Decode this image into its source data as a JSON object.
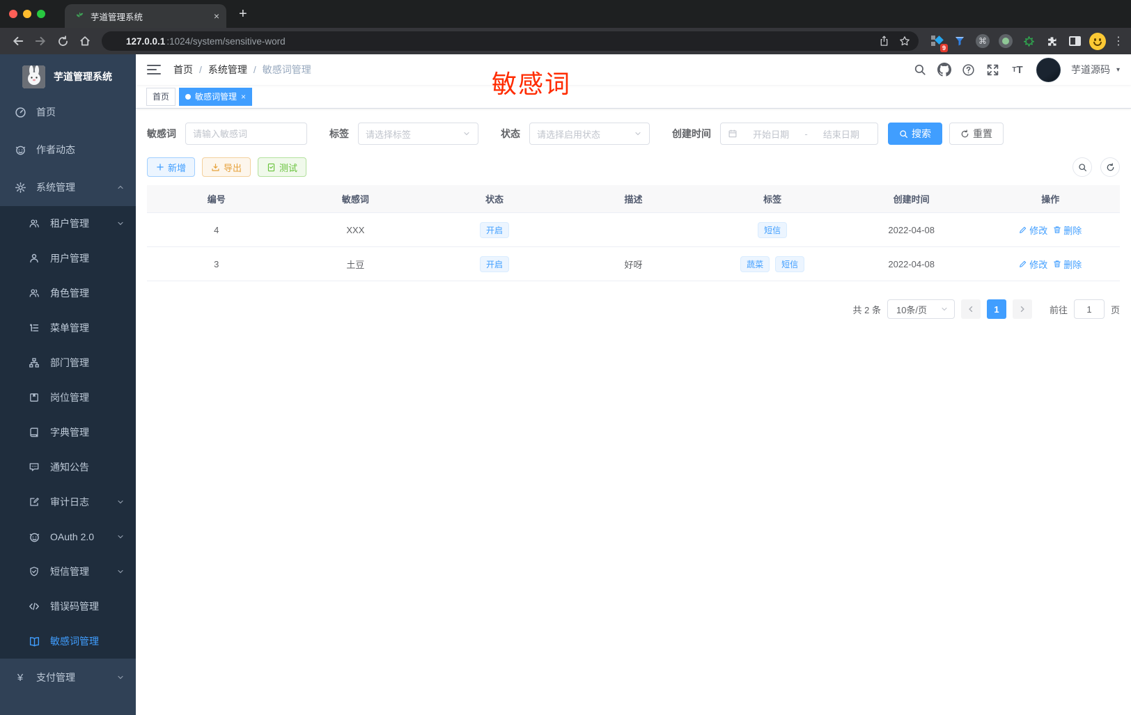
{
  "colors": {
    "accent": "#409eff",
    "success": "#67c23a",
    "warning": "#e6a23c",
    "annotation_red": "#ff2b00",
    "sidebar_bg": "#304156",
    "submenu_bg": "#1f2d3d"
  },
  "browser": {
    "tab_title": "芋道管理系统",
    "url_host": "127.0.0.1",
    "url_path": ":1024/system/sensitive-word",
    "extension_badge": "9"
  },
  "sidebar": {
    "app_title": "芋道管理系统",
    "top_items": [
      {
        "label": "首页"
      },
      {
        "label": "作者动态"
      },
      {
        "label": "系统管理"
      }
    ],
    "system_children": [
      {
        "label": "租户管理"
      },
      {
        "label": "用户管理"
      },
      {
        "label": "角色管理"
      },
      {
        "label": "菜单管理"
      },
      {
        "label": "部门管理"
      },
      {
        "label": "岗位管理"
      },
      {
        "label": "字典管理"
      },
      {
        "label": "通知公告"
      },
      {
        "label": "审计日志"
      },
      {
        "label": "OAuth 2.0"
      },
      {
        "label": "短信管理"
      },
      {
        "label": "错误码管理"
      },
      {
        "label": "敏感词管理"
      }
    ],
    "bottom_items": [
      {
        "label": "支付管理"
      }
    ]
  },
  "header": {
    "breadcrumb": [
      "首页",
      "系统管理",
      "敏感词管理"
    ],
    "annotation": "敏感词",
    "user_name": "芋道源码"
  },
  "tabs": {
    "items": [
      {
        "label": "首页"
      },
      {
        "label": "敏感词管理"
      }
    ]
  },
  "filters": {
    "keyword_label": "敏感词",
    "keyword_placeholder": "请输入敏感词",
    "tag_label": "标签",
    "tag_placeholder": "请选择标签",
    "status_label": "状态",
    "status_placeholder": "请选择启用状态",
    "date_label": "创建时间",
    "date_start": "开始日期",
    "date_sep": "-",
    "date_end": "结束日期",
    "search": "搜索",
    "reset": "重置"
  },
  "toolbar": {
    "add": "新增",
    "export": "导出",
    "test": "测试"
  },
  "table": {
    "headers": [
      "编号",
      "敏感词",
      "状态",
      "描述",
      "标签",
      "创建时间",
      "操作"
    ],
    "ops": {
      "edit": "修改",
      "delete": "删除"
    },
    "rows": [
      {
        "id": "4",
        "word": "XXX",
        "status": "开启",
        "description": "",
        "tags": [
          "短信"
        ],
        "create_time": "2022-04-08"
      },
      {
        "id": "3",
        "word": "土豆",
        "status": "开启",
        "description": "好呀",
        "tags": [
          "蔬菜",
          "短信"
        ],
        "create_time": "2022-04-08"
      }
    ]
  },
  "pagination": {
    "total": "共 2 条",
    "page_size": "10条/页",
    "page": "1",
    "goto_label": "前往",
    "goto_value": "1",
    "unit": "页"
  }
}
